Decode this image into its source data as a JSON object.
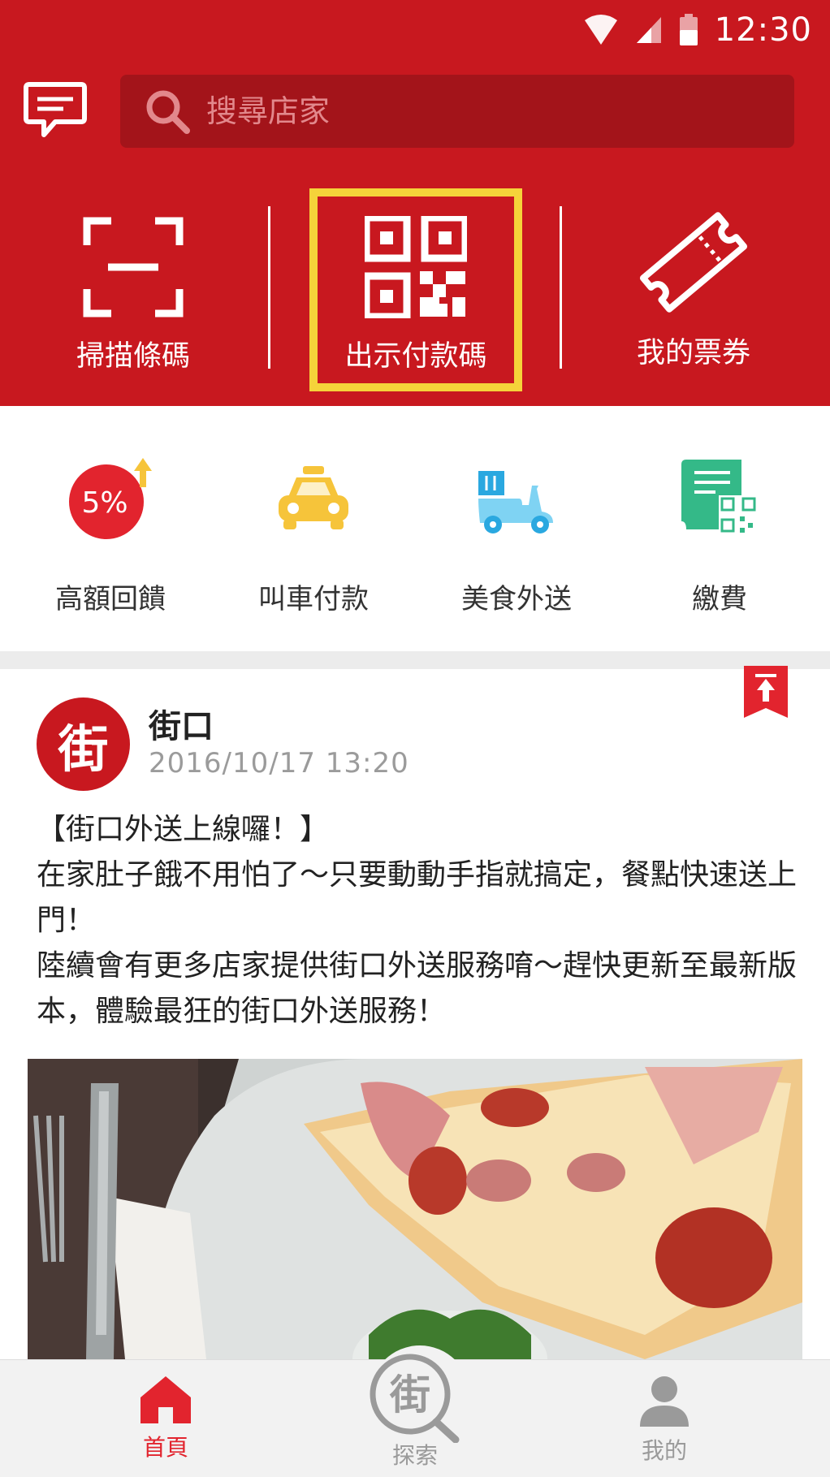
{
  "status_bar": {
    "time": "12:30",
    "wifi_icon": "wifi-icon",
    "signal_icon": "signal-icon",
    "battery_icon": "battery-icon"
  },
  "header": {
    "message_icon": "chat-icon",
    "search": {
      "placeholder": "搜尋店家",
      "icon": "search-icon"
    },
    "brand_color": "#c8181f",
    "highlight_color": "#f5d33a"
  },
  "quick_actions": [
    {
      "label": "掃描條碼",
      "icon": "scan-icon"
    },
    {
      "label": "出示付款碼",
      "icon": "qr-code-icon",
      "highlighted": true
    },
    {
      "label": "我的票券",
      "icon": "ticket-icon"
    }
  ],
  "services": [
    {
      "label": "高額回饋",
      "icon": "cashback-icon",
      "badge": "5%"
    },
    {
      "label": "叫車付款",
      "icon": "taxi-icon"
    },
    {
      "label": "美食外送",
      "icon": "delivery-scooter-icon"
    },
    {
      "label": "繳費",
      "icon": "bill-icon"
    }
  ],
  "post": {
    "avatar_text": "街",
    "author": "街口",
    "timestamp": "2016/10/17  13:20",
    "body": [
      "【街口外送上線囉！】",
      "在家肚子餓不用怕了～只要動動手指就搞定，餐點快速送上門！",
      "陸續會有更多店家提供街口外送服務唷～趕快更新至最新版本，體驗最狂的街口外送服務！"
    ],
    "bookmark_icon": "pin-top-icon",
    "image": "pizza-photo"
  },
  "bottom_nav": [
    {
      "label": "首頁",
      "icon": "home-icon",
      "active": true
    },
    {
      "label": "探索",
      "icon": "explore-icon",
      "active": false,
      "icon_text": "街"
    },
    {
      "label": "我的",
      "icon": "profile-icon",
      "active": false
    }
  ]
}
